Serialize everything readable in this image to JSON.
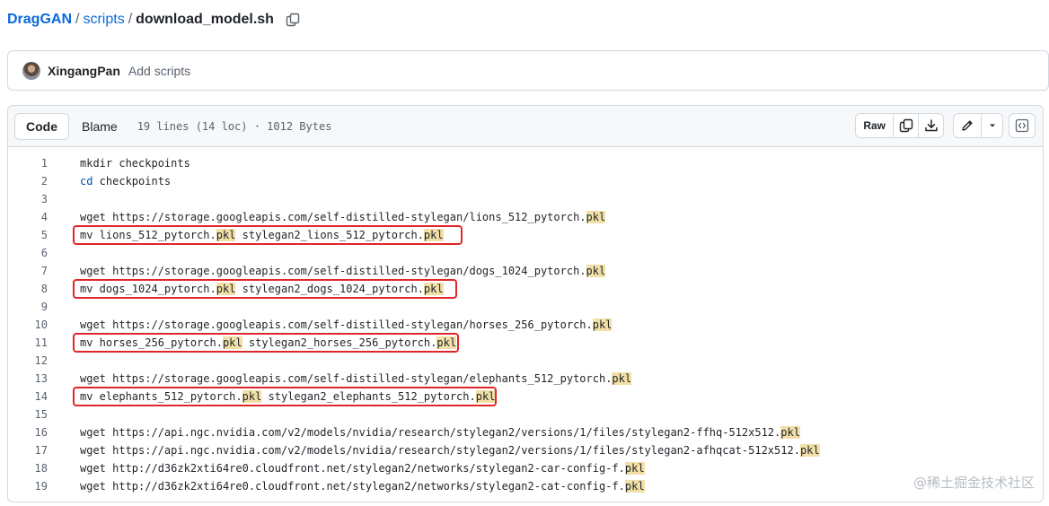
{
  "breadcrumb": {
    "repo": "DragGAN",
    "separator": "/",
    "folder": "scripts",
    "file": "download_model.sh"
  },
  "commit": {
    "author": "XingangPan",
    "message": "Add scripts"
  },
  "file_header": {
    "tabs": [
      "Code",
      "Blame"
    ],
    "active_tab": "Code",
    "meta": "19 lines (14 loc) · 1012 Bytes",
    "raw_label": "Raw"
  },
  "code_lines": [
    {
      "num": "1",
      "text": "mkdir checkpoints"
    },
    {
      "num": "2",
      "keyword": "cd",
      "text": " checkpoints"
    },
    {
      "num": "3",
      "text": ""
    },
    {
      "num": "4",
      "text": "wget https://storage.googleapis.com/self-distilled-stylegan/lions_512_pytorch.",
      "hl": "pkl"
    },
    {
      "num": "5",
      "text": "mv lions_512_pytorch.",
      "hl": "pkl",
      "text2": " stylegan2_lions_512_pytorch.",
      "hl2": "pkl",
      "boxed": true
    },
    {
      "num": "6",
      "text": ""
    },
    {
      "num": "7",
      "text": "wget https://storage.googleapis.com/self-distilled-stylegan/dogs_1024_pytorch.",
      "hl": "pkl"
    },
    {
      "num": "8",
      "text": "mv dogs_1024_pytorch.",
      "hl": "pkl",
      "text2": " stylegan2_dogs_1024_pytorch.",
      "hl2": "pkl",
      "boxed": true
    },
    {
      "num": "9",
      "text": ""
    },
    {
      "num": "10",
      "text": "wget https://storage.googleapis.com/self-distilled-stylegan/horses_256_pytorch.",
      "hl": "pkl"
    },
    {
      "num": "11",
      "text": "mv horses_256_pytorch.",
      "hl": "pkl",
      "text2": " stylegan2_horses_256_pytorch.",
      "hl2": "pkl",
      "boxed": true
    },
    {
      "num": "12",
      "text": ""
    },
    {
      "num": "13",
      "text": "wget https://storage.googleapis.com/self-distilled-stylegan/elephants_512_pytorch.",
      "hl": "pkl"
    },
    {
      "num": "14",
      "text": "mv elephants_512_pytorch.",
      "hl": "pkl",
      "text2": " stylegan2_elephants_512_pytorch.",
      "hl2": "pkl",
      "boxed": true
    },
    {
      "num": "15",
      "text": ""
    },
    {
      "num": "16",
      "text": "wget https://api.ngc.nvidia.com/v2/models/nvidia/research/stylegan2/versions/1/files/stylegan2-ffhq-512x512.",
      "hl": "pkl"
    },
    {
      "num": "17",
      "text": "wget https://api.ngc.nvidia.com/v2/models/nvidia/research/stylegan2/versions/1/files/stylegan2-afhqcat-512x512.",
      "hl": "pkl"
    },
    {
      "num": "18",
      "text": "wget http://d36zk2xti64re0.cloudfront.net/stylegan2/networks/stylegan2-car-config-f.",
      "hl": "pkl"
    },
    {
      "num": "19",
      "text": "wget http://d36zk2xti64re0.cloudfront.net/stylegan2/networks/stylegan2-cat-config-f.",
      "hl": "pkl"
    }
  ],
  "icons": [
    "copy-path-icon",
    "copy-raw-icon",
    "download-icon",
    "pencil-icon",
    "chevron-down-icon",
    "code-symbols-icon"
  ],
  "colors": {
    "link": "#0969da",
    "highlight": "#f1dfa7",
    "annotation_box": "#e0262a",
    "keyword": "#0550ae"
  },
  "watermark": "@稀土掘金技术社区"
}
